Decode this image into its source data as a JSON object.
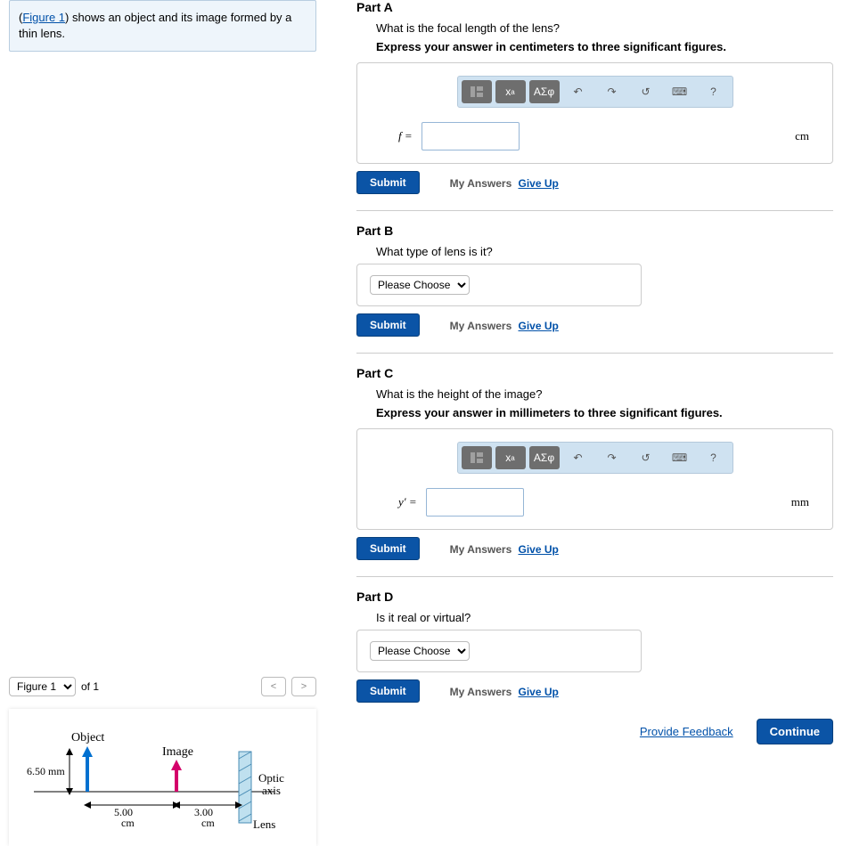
{
  "left": {
    "item_title": "",
    "figure_link": "Figure 1",
    "prompt_prefix": "(",
    "prompt_mid": ") shows an object and its image formed by a thin lens.",
    "fig_sel": "Figure 1",
    "of_lbl": "of 1",
    "prev": "<",
    "next": ">"
  },
  "parts": {
    "A": {
      "title": "Part A",
      "q": "What is the focal length of the lens?",
      "instruct": "Express your answer in centimeters to three significant figures.",
      "var": "f =",
      "unit": "cm"
    },
    "B": {
      "title": "Part B",
      "q": "What type of lens is it?",
      "choice": "Please Choose"
    },
    "C": {
      "title": "Part C",
      "q": "What is the height of the image?",
      "instruct": "Express your answer in millimeters to three significant figures.",
      "var": "y′ =",
      "unit": "mm"
    },
    "D": {
      "title": "Part D",
      "q": "Is it real or virtual?",
      "choice": "Please Choose"
    }
  },
  "toolbar": {
    "sqrt": "√",
    "greek": "ΑΣφ",
    "undo": "↶",
    "redo": "↷",
    "reset": "↺",
    "kbd": "⌨",
    "help": "?"
  },
  "actions": {
    "submit": "Submit",
    "my_answers": "My Answers",
    "give_up": "Give Up",
    "provide_feedback": "Provide Feedback",
    "continue": "Continue"
  },
  "figure": {
    "object_lbl": "Object",
    "image_lbl": "Image",
    "optic_axis": "Optic axis",
    "lens_lbl": "Lens",
    "obj_height": "6.50 mm",
    "dist1": "5.00 cm",
    "dist2": "3.00 cm"
  },
  "chart_data": {
    "type": "diagram",
    "description": "Thin-lens ray diagram on an optic axis",
    "object_height_mm": 6.5,
    "object_to_image_distance_cm": 5.0,
    "image_to_lens_distance_cm": 3.0,
    "object_arrow": {
      "position": "left",
      "direction": "up",
      "color": "blue"
    },
    "image_arrow": {
      "position": "middle",
      "direction": "up",
      "color": "magenta"
    },
    "lens": {
      "position": "right",
      "style": "hatched-vertical-rectangle"
    },
    "axis_label": "Optic axis"
  }
}
